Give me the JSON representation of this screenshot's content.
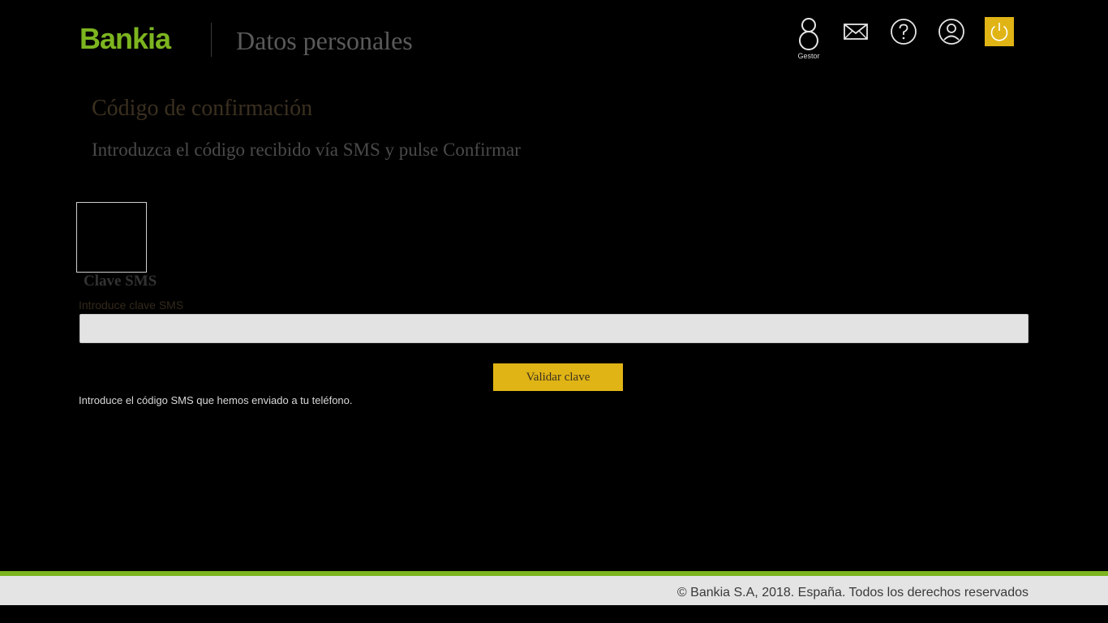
{
  "header": {
    "logo_text": "Bankia",
    "section_title": "Datos personales",
    "gestor_label": "Gestor",
    "brand_color": "#7cb51f",
    "accent_color": "#e0b415",
    "icons": [
      "gestor-icon",
      "mail-icon",
      "help-icon",
      "user-icon",
      "power-icon"
    ]
  },
  "main": {
    "title": "Código de confirmación",
    "subtitle": "Introduzca el código recibido vía SMS y pulse Confirmar",
    "field_title": "Clave SMS",
    "input_label": "Introduce clave SMS",
    "input_value": "",
    "input_placeholder": "",
    "validate_button": "Validar clave",
    "help_text": "Introduce el código SMS que hemos enviado a tu teléfono."
  },
  "footer": {
    "copyright": "© Bankia S.A, 2018. España. Todos los derechos reservados"
  }
}
